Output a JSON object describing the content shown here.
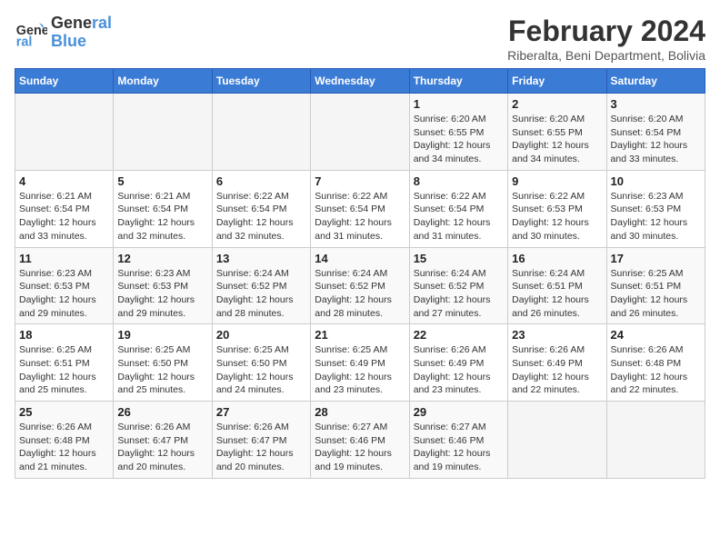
{
  "header": {
    "logo_general": "General",
    "logo_blue": "Blue",
    "month_year": "February 2024",
    "location": "Riberalta, Beni Department, Bolivia"
  },
  "days_of_week": [
    "Sunday",
    "Monday",
    "Tuesday",
    "Wednesday",
    "Thursday",
    "Friday",
    "Saturday"
  ],
  "weeks": [
    [
      {
        "day": "",
        "info": ""
      },
      {
        "day": "",
        "info": ""
      },
      {
        "day": "",
        "info": ""
      },
      {
        "day": "",
        "info": ""
      },
      {
        "day": "1",
        "info": "Sunrise: 6:20 AM\nSunset: 6:55 PM\nDaylight: 12 hours\nand 34 minutes."
      },
      {
        "day": "2",
        "info": "Sunrise: 6:20 AM\nSunset: 6:55 PM\nDaylight: 12 hours\nand 34 minutes."
      },
      {
        "day": "3",
        "info": "Sunrise: 6:20 AM\nSunset: 6:54 PM\nDaylight: 12 hours\nand 33 minutes."
      }
    ],
    [
      {
        "day": "4",
        "info": "Sunrise: 6:21 AM\nSunset: 6:54 PM\nDaylight: 12 hours\nand 33 minutes."
      },
      {
        "day": "5",
        "info": "Sunrise: 6:21 AM\nSunset: 6:54 PM\nDaylight: 12 hours\nand 32 minutes."
      },
      {
        "day": "6",
        "info": "Sunrise: 6:22 AM\nSunset: 6:54 PM\nDaylight: 12 hours\nand 32 minutes."
      },
      {
        "day": "7",
        "info": "Sunrise: 6:22 AM\nSunset: 6:54 PM\nDaylight: 12 hours\nand 31 minutes."
      },
      {
        "day": "8",
        "info": "Sunrise: 6:22 AM\nSunset: 6:54 PM\nDaylight: 12 hours\nand 31 minutes."
      },
      {
        "day": "9",
        "info": "Sunrise: 6:22 AM\nSunset: 6:53 PM\nDaylight: 12 hours\nand 30 minutes."
      },
      {
        "day": "10",
        "info": "Sunrise: 6:23 AM\nSunset: 6:53 PM\nDaylight: 12 hours\nand 30 minutes."
      }
    ],
    [
      {
        "day": "11",
        "info": "Sunrise: 6:23 AM\nSunset: 6:53 PM\nDaylight: 12 hours\nand 29 minutes."
      },
      {
        "day": "12",
        "info": "Sunrise: 6:23 AM\nSunset: 6:53 PM\nDaylight: 12 hours\nand 29 minutes."
      },
      {
        "day": "13",
        "info": "Sunrise: 6:24 AM\nSunset: 6:52 PM\nDaylight: 12 hours\nand 28 minutes."
      },
      {
        "day": "14",
        "info": "Sunrise: 6:24 AM\nSunset: 6:52 PM\nDaylight: 12 hours\nand 28 minutes."
      },
      {
        "day": "15",
        "info": "Sunrise: 6:24 AM\nSunset: 6:52 PM\nDaylight: 12 hours\nand 27 minutes."
      },
      {
        "day": "16",
        "info": "Sunrise: 6:24 AM\nSunset: 6:51 PM\nDaylight: 12 hours\nand 26 minutes."
      },
      {
        "day": "17",
        "info": "Sunrise: 6:25 AM\nSunset: 6:51 PM\nDaylight: 12 hours\nand 26 minutes."
      }
    ],
    [
      {
        "day": "18",
        "info": "Sunrise: 6:25 AM\nSunset: 6:51 PM\nDaylight: 12 hours\nand 25 minutes."
      },
      {
        "day": "19",
        "info": "Sunrise: 6:25 AM\nSunset: 6:50 PM\nDaylight: 12 hours\nand 25 minutes."
      },
      {
        "day": "20",
        "info": "Sunrise: 6:25 AM\nSunset: 6:50 PM\nDaylight: 12 hours\nand 24 minutes."
      },
      {
        "day": "21",
        "info": "Sunrise: 6:25 AM\nSunset: 6:49 PM\nDaylight: 12 hours\nand 23 minutes."
      },
      {
        "day": "22",
        "info": "Sunrise: 6:26 AM\nSunset: 6:49 PM\nDaylight: 12 hours\nand 23 minutes."
      },
      {
        "day": "23",
        "info": "Sunrise: 6:26 AM\nSunset: 6:49 PM\nDaylight: 12 hours\nand 22 minutes."
      },
      {
        "day": "24",
        "info": "Sunrise: 6:26 AM\nSunset: 6:48 PM\nDaylight: 12 hours\nand 22 minutes."
      }
    ],
    [
      {
        "day": "25",
        "info": "Sunrise: 6:26 AM\nSunset: 6:48 PM\nDaylight: 12 hours\nand 21 minutes."
      },
      {
        "day": "26",
        "info": "Sunrise: 6:26 AM\nSunset: 6:47 PM\nDaylight: 12 hours\nand 20 minutes."
      },
      {
        "day": "27",
        "info": "Sunrise: 6:26 AM\nSunset: 6:47 PM\nDaylight: 12 hours\nand 20 minutes."
      },
      {
        "day": "28",
        "info": "Sunrise: 6:27 AM\nSunset: 6:46 PM\nDaylight: 12 hours\nand 19 minutes."
      },
      {
        "day": "29",
        "info": "Sunrise: 6:27 AM\nSunset: 6:46 PM\nDaylight: 12 hours\nand 19 minutes."
      },
      {
        "day": "",
        "info": ""
      },
      {
        "day": "",
        "info": ""
      }
    ]
  ]
}
